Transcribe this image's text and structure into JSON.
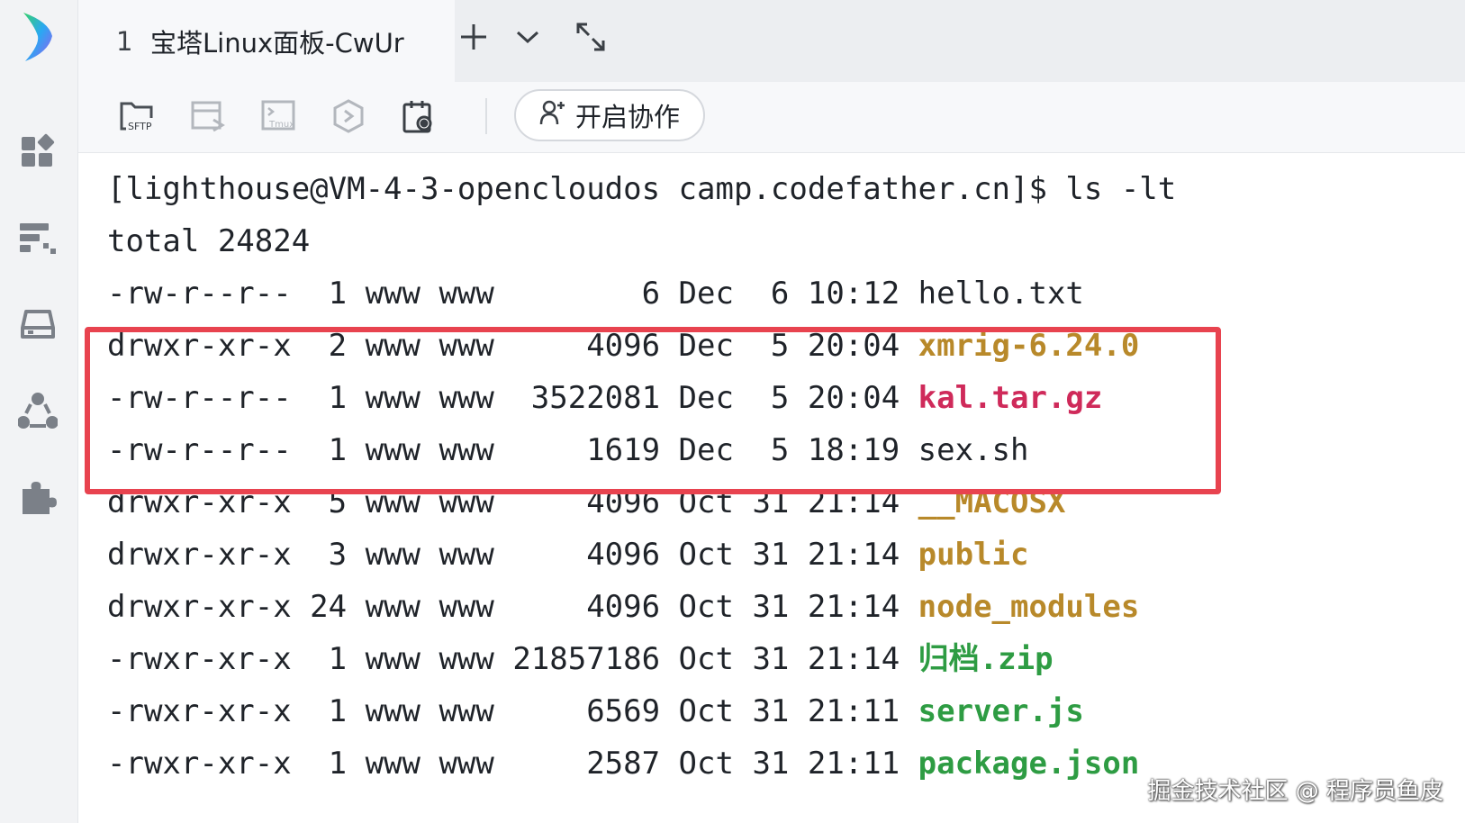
{
  "tab": {
    "number": "1",
    "title": "宝塔Linux面板-CwUr"
  },
  "icons": {
    "logo": "app-logo-icon",
    "sidebar": [
      "dashboard-icon",
      "devops-icon",
      "disk-icon",
      "cluster-icon",
      "plugin-icon"
    ],
    "tabbar": [
      "plus-icon",
      "chevron-down-icon",
      "expand-icon"
    ],
    "toolbar": [
      "sftp-icon",
      "file-transfer-icon",
      "tmux-icon",
      "shield-icon",
      "snapshot-icon"
    ]
  },
  "toolbar": {
    "sftp_label": "SFTP",
    "tmux_label": "Tmux",
    "collab_label": "开启协作"
  },
  "terminal": {
    "prompt": "[lighthouse@VM-4-3-opencloudos camp.codefather.cn]$ ls -lt",
    "total": "total 24824",
    "rows": [
      {
        "meta": "-rw-r--r--  1 www www        6 Dec  6 10:12 ",
        "name": "hello.txt",
        "type": "file"
      },
      {
        "meta": "drwxr-xr-x  2 www www     4096 Dec  5 20:04 ",
        "name": "xmrig-6.24.0",
        "type": "dir"
      },
      {
        "meta": "-rw-r--r--  1 www www  3522081 Dec  5 20:04 ",
        "name": "kal.tar.gz",
        "type": "archive"
      },
      {
        "meta": "-rw-r--r--  1 www www     1619 Dec  5 18:19 ",
        "name": "sex.sh",
        "type": "file"
      },
      {
        "meta": "drwxr-xr-x  5 www www     4096 Oct 31 21:14 ",
        "name": "__MACOSX",
        "type": "dir"
      },
      {
        "meta": "drwxr-xr-x  3 www www     4096 Oct 31 21:14 ",
        "name": "public",
        "type": "dir"
      },
      {
        "meta": "drwxr-xr-x 24 www www     4096 Oct 31 21:14 ",
        "name": "node_modules",
        "type": "dir"
      },
      {
        "meta": "-rwxr-xr-x  1 www www 21857186 Oct 31 21:14 ",
        "name": "归档.zip",
        "type": "exe"
      },
      {
        "meta": "-rwxr-xr-x  1 www www     6569 Oct 31 21:11 ",
        "name": "server.js",
        "type": "exe"
      },
      {
        "meta": "-rwxr-xr-x  1 www www     2587 Oct 31 21:11 ",
        "name": "package.json",
        "type": "exe"
      }
    ]
  },
  "colors": {
    "dir": "#b8892a",
    "archive": "#cf2a5a",
    "exe": "#2e9c43",
    "highlight_border": "#e8434f"
  },
  "watermark": "掘金技术社区 @ 程序员鱼皮"
}
